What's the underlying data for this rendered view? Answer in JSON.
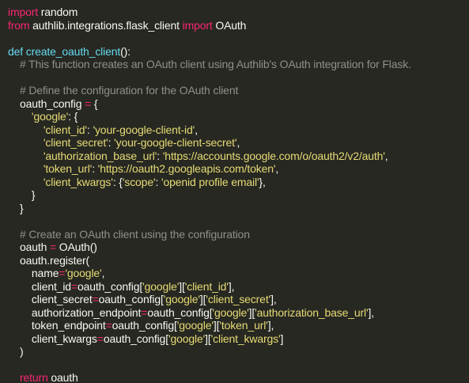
{
  "colors": {
    "background": "#272822",
    "keyword": "#f92672",
    "function": "#66d9ef",
    "string": "#e6db74",
    "comment": "#8f908a",
    "text": "#f8f8f2"
  },
  "lines": [
    [
      {
        "t": "kw",
        "v": "import"
      },
      {
        "t": "plain",
        "v": " random"
      }
    ],
    [
      {
        "t": "kw",
        "v": "from"
      },
      {
        "t": "plain",
        "v": " authlib.integrations.flask_client "
      },
      {
        "t": "kw",
        "v": "import"
      },
      {
        "t": "plain",
        "v": " OAuth"
      }
    ],
    [],
    [
      {
        "t": "fn",
        "v": "def"
      },
      {
        "t": "plain",
        "v": " "
      },
      {
        "t": "fn",
        "v": "create_oauth_client"
      },
      {
        "t": "plain",
        "v": "():"
      }
    ],
    [
      {
        "t": "cm",
        "v": "    # This function creates an OAuth client using Authlib's OAuth integration for Flask."
      }
    ],
    [],
    [
      {
        "t": "cm",
        "v": "    # Define the configuration for the OAuth client"
      }
    ],
    [
      {
        "t": "plain",
        "v": "    oauth_config "
      },
      {
        "t": "op",
        "v": "="
      },
      {
        "t": "plain",
        "v": " {"
      }
    ],
    [
      {
        "t": "plain",
        "v": "        "
      },
      {
        "t": "str",
        "v": "'google'"
      },
      {
        "t": "plain",
        "v": ": {"
      }
    ],
    [
      {
        "t": "plain",
        "v": "            "
      },
      {
        "t": "str",
        "v": "'client_id'"
      },
      {
        "t": "plain",
        "v": ": "
      },
      {
        "t": "str",
        "v": "'your-google-client-id'"
      },
      {
        "t": "plain",
        "v": ","
      }
    ],
    [
      {
        "t": "plain",
        "v": "            "
      },
      {
        "t": "str",
        "v": "'client_secret'"
      },
      {
        "t": "plain",
        "v": ": "
      },
      {
        "t": "str",
        "v": "'your-google-client-secret'"
      },
      {
        "t": "plain",
        "v": ","
      }
    ],
    [
      {
        "t": "plain",
        "v": "            "
      },
      {
        "t": "str",
        "v": "'authorization_base_url'"
      },
      {
        "t": "plain",
        "v": ": "
      },
      {
        "t": "str",
        "v": "'https://accounts.google.com/o/oauth2/v2/auth'"
      },
      {
        "t": "plain",
        "v": ","
      }
    ],
    [
      {
        "t": "plain",
        "v": "            "
      },
      {
        "t": "str",
        "v": "'token_url'"
      },
      {
        "t": "plain",
        "v": ": "
      },
      {
        "t": "str",
        "v": "'https://oauth2.googleapis.com/token'"
      },
      {
        "t": "plain",
        "v": ","
      }
    ],
    [
      {
        "t": "plain",
        "v": "            "
      },
      {
        "t": "str",
        "v": "'client_kwargs'"
      },
      {
        "t": "plain",
        "v": ": {"
      },
      {
        "t": "str",
        "v": "'scope'"
      },
      {
        "t": "plain",
        "v": ": "
      },
      {
        "t": "str",
        "v": "'openid profile email'"
      },
      {
        "t": "plain",
        "v": "},"
      }
    ],
    [
      {
        "t": "plain",
        "v": "        }"
      }
    ],
    [
      {
        "t": "plain",
        "v": "    }"
      }
    ],
    [],
    [
      {
        "t": "cm",
        "v": "    # Create an OAuth client using the configuration"
      }
    ],
    [
      {
        "t": "plain",
        "v": "    oauth "
      },
      {
        "t": "op",
        "v": "="
      },
      {
        "t": "plain",
        "v": " OAuth()"
      }
    ],
    [
      {
        "t": "plain",
        "v": "    oauth.register("
      }
    ],
    [
      {
        "t": "plain",
        "v": "        name"
      },
      {
        "t": "op",
        "v": "="
      },
      {
        "t": "str",
        "v": "'google'"
      },
      {
        "t": "plain",
        "v": ","
      }
    ],
    [
      {
        "t": "plain",
        "v": "        client_id"
      },
      {
        "t": "op",
        "v": "="
      },
      {
        "t": "plain",
        "v": "oauth_config["
      },
      {
        "t": "str",
        "v": "'google'"
      },
      {
        "t": "plain",
        "v": "]["
      },
      {
        "t": "str",
        "v": "'client_id'"
      },
      {
        "t": "plain",
        "v": "],"
      }
    ],
    [
      {
        "t": "plain",
        "v": "        client_secret"
      },
      {
        "t": "op",
        "v": "="
      },
      {
        "t": "plain",
        "v": "oauth_config["
      },
      {
        "t": "str",
        "v": "'google'"
      },
      {
        "t": "plain",
        "v": "]["
      },
      {
        "t": "str",
        "v": "'client_secret'"
      },
      {
        "t": "plain",
        "v": "],"
      }
    ],
    [
      {
        "t": "plain",
        "v": "        authorization_endpoint"
      },
      {
        "t": "op",
        "v": "="
      },
      {
        "t": "plain",
        "v": "oauth_config["
      },
      {
        "t": "str",
        "v": "'google'"
      },
      {
        "t": "plain",
        "v": "]["
      },
      {
        "t": "str",
        "v": "'authorization_base_url'"
      },
      {
        "t": "plain",
        "v": "],"
      }
    ],
    [
      {
        "t": "plain",
        "v": "        token_endpoint"
      },
      {
        "t": "op",
        "v": "="
      },
      {
        "t": "plain",
        "v": "oauth_config["
      },
      {
        "t": "str",
        "v": "'google'"
      },
      {
        "t": "plain",
        "v": "]["
      },
      {
        "t": "str",
        "v": "'token_url'"
      },
      {
        "t": "plain",
        "v": "],"
      }
    ],
    [
      {
        "t": "plain",
        "v": "        client_kwargs"
      },
      {
        "t": "op",
        "v": "="
      },
      {
        "t": "plain",
        "v": "oauth_config["
      },
      {
        "t": "str",
        "v": "'google'"
      },
      {
        "t": "plain",
        "v": "]["
      },
      {
        "t": "str",
        "v": "'client_kwargs'"
      },
      {
        "t": "plain",
        "v": "]"
      }
    ],
    [
      {
        "t": "plain",
        "v": "    )"
      }
    ],
    [],
    [
      {
        "t": "kw",
        "v": "    return"
      },
      {
        "t": "plain",
        "v": " oauth"
      }
    ]
  ]
}
